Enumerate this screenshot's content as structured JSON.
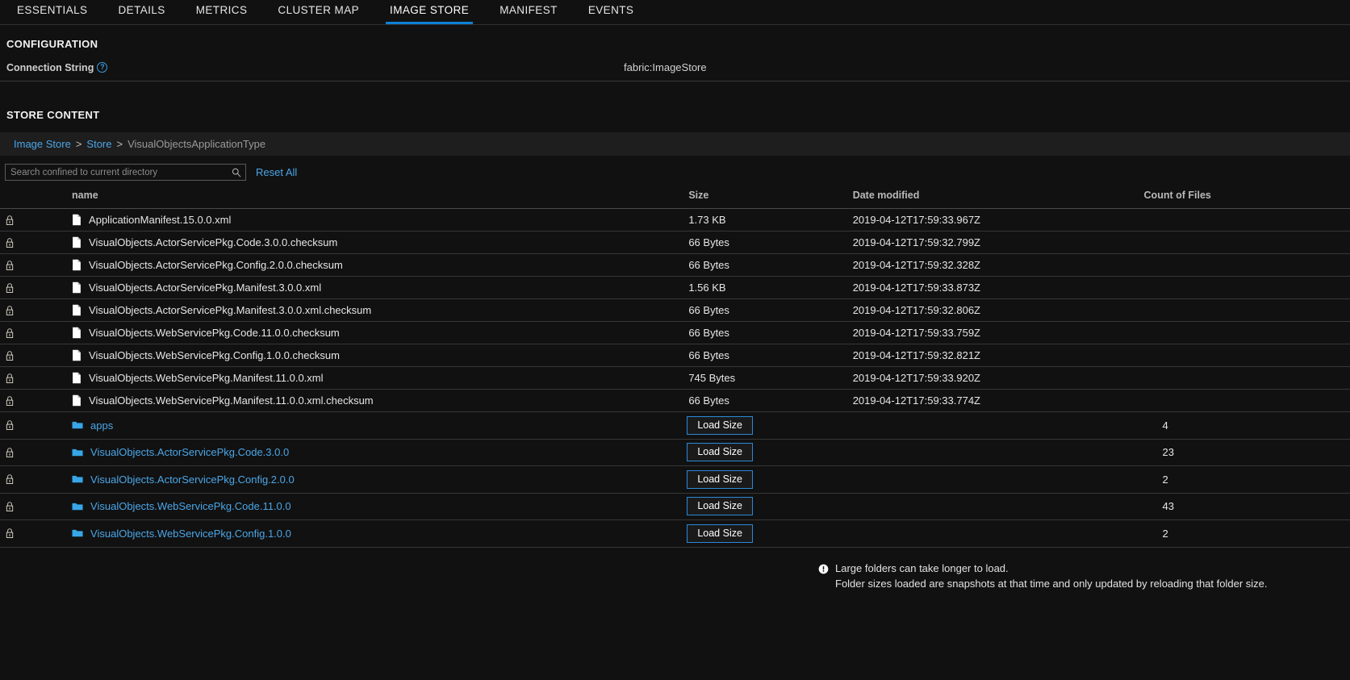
{
  "tabs": [
    {
      "label": "ESSENTIALS",
      "active": false
    },
    {
      "label": "DETAILS",
      "active": false
    },
    {
      "label": "METRICS",
      "active": false
    },
    {
      "label": "CLUSTER MAP",
      "active": false
    },
    {
      "label": "IMAGE STORE",
      "active": true
    },
    {
      "label": "MANIFEST",
      "active": false
    },
    {
      "label": "EVENTS",
      "active": false
    }
  ],
  "configuration": {
    "heading": "CONFIGURATION",
    "connection_string_label": "Connection String",
    "help_glyph": "?",
    "connection_string_value": "fabric:ImageStore"
  },
  "store_content": {
    "heading": "STORE CONTENT",
    "breadcrumb": {
      "items": [
        {
          "label": "Image Store",
          "link": true
        },
        {
          "label": "Store",
          "link": true
        },
        {
          "label": "VisualObjectsApplicationType",
          "link": false
        }
      ],
      "separator": ">"
    },
    "search": {
      "placeholder": "Search confined to current directory",
      "value": "",
      "icon": "search-icon"
    },
    "reset_all_label": "Reset All",
    "columns": {
      "name": "name",
      "size": "Size",
      "date_modified": "Date modified",
      "count_of_files": "Count of Files"
    },
    "load_size_label": "Load Size",
    "rows": [
      {
        "lock": "lock-icon",
        "icon": "file-icon",
        "name": "ApplicationManifest.15.0.0.xml",
        "type": "file",
        "size": "1.73 KB",
        "date": "2019-04-12T17:59:33.967Z",
        "count": ""
      },
      {
        "lock": "lock-icon",
        "icon": "file-icon",
        "name": "VisualObjects.ActorServicePkg.Code.3.0.0.checksum",
        "type": "file",
        "size": "66 Bytes",
        "date": "2019-04-12T17:59:32.799Z",
        "count": ""
      },
      {
        "lock": "lock-icon",
        "icon": "file-icon",
        "name": "VisualObjects.ActorServicePkg.Config.2.0.0.checksum",
        "type": "file",
        "size": "66 Bytes",
        "date": "2019-04-12T17:59:32.328Z",
        "count": ""
      },
      {
        "lock": "lock-icon",
        "icon": "file-icon",
        "name": "VisualObjects.ActorServicePkg.Manifest.3.0.0.xml",
        "type": "file",
        "size": "1.56 KB",
        "date": "2019-04-12T17:59:33.873Z",
        "count": ""
      },
      {
        "lock": "lock-icon",
        "icon": "file-icon",
        "name": "VisualObjects.ActorServicePkg.Manifest.3.0.0.xml.checksum",
        "type": "file",
        "size": "66 Bytes",
        "date": "2019-04-12T17:59:32.806Z",
        "count": ""
      },
      {
        "lock": "lock-icon",
        "icon": "file-icon",
        "name": "VisualObjects.WebServicePkg.Code.11.0.0.checksum",
        "type": "file",
        "size": "66 Bytes",
        "date": "2019-04-12T17:59:33.759Z",
        "count": ""
      },
      {
        "lock": "lock-icon",
        "icon": "file-icon",
        "name": "VisualObjects.WebServicePkg.Config.1.0.0.checksum",
        "type": "file",
        "size": "66 Bytes",
        "date": "2019-04-12T17:59:32.821Z",
        "count": ""
      },
      {
        "lock": "lock-icon",
        "icon": "file-icon",
        "name": "VisualObjects.WebServicePkg.Manifest.11.0.0.xml",
        "type": "file",
        "size": "745 Bytes",
        "date": "2019-04-12T17:59:33.920Z",
        "count": ""
      },
      {
        "lock": "lock-icon",
        "icon": "file-icon",
        "name": "VisualObjects.WebServicePkg.Manifest.11.0.0.xml.checksum",
        "type": "file",
        "size": "66 Bytes",
        "date": "2019-04-12T17:59:33.774Z",
        "count": ""
      },
      {
        "lock": "lock-icon",
        "icon": "folder-icon",
        "name": "apps",
        "type": "folder",
        "size": "",
        "date": "",
        "count": "4"
      },
      {
        "lock": "lock-icon",
        "icon": "folder-icon",
        "name": "VisualObjects.ActorServicePkg.Code.3.0.0",
        "type": "folder",
        "size": "",
        "date": "",
        "count": "23"
      },
      {
        "lock": "lock-icon",
        "icon": "folder-icon",
        "name": "VisualObjects.ActorServicePkg.Config.2.0.0",
        "type": "folder",
        "size": "",
        "date": "",
        "count": "2"
      },
      {
        "lock": "lock-icon",
        "icon": "folder-icon",
        "name": "VisualObjects.WebServicePkg.Code.11.0.0",
        "type": "folder",
        "size": "",
        "date": "",
        "count": "43"
      },
      {
        "lock": "lock-icon",
        "icon": "folder-icon",
        "name": "VisualObjects.WebServicePkg.Config.1.0.0",
        "type": "folder",
        "size": "",
        "date": "",
        "count": "2"
      }
    ],
    "footnote": {
      "icon": "alert-circle-icon",
      "line1": "Large folders can take longer to load.",
      "line2": "Folder sizes loaded are snapshots at that time and only updated by reloading that folder size."
    }
  },
  "colors": {
    "accent_blue": "#0c82d6",
    "link_blue": "#4ba6e8",
    "background": "#111111",
    "breadcrumb_bg": "#1e1e1e"
  }
}
